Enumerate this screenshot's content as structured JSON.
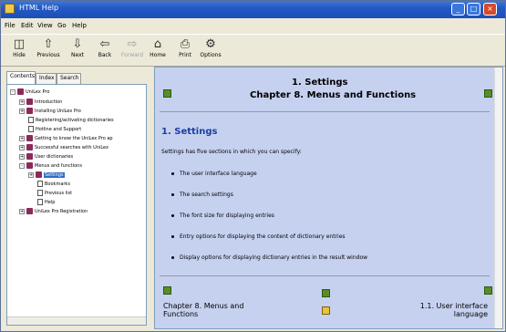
{
  "window": {
    "title": "HTML Help"
  },
  "menu": [
    "File",
    "Edit",
    "View",
    "Go",
    "Help"
  ],
  "toolbar": [
    {
      "label": "Hide",
      "icon": "hide-icon",
      "enabled": true
    },
    {
      "label": "Previous",
      "icon": "previous-icon",
      "enabled": true
    },
    {
      "label": "Next",
      "icon": "next-icon",
      "enabled": true
    },
    {
      "label": "Back",
      "icon": "back-icon",
      "enabled": true
    },
    {
      "label": "Forward",
      "icon": "forward-icon",
      "enabled": false
    },
    {
      "label": "Home",
      "icon": "home-icon",
      "enabled": true
    },
    {
      "label": "Print",
      "icon": "print-icon",
      "enabled": true
    },
    {
      "label": "Options",
      "icon": "options-icon",
      "enabled": true
    }
  ],
  "tabs": [
    "Contents",
    "Index",
    "Search"
  ],
  "tree": {
    "root": "UniLex Pro",
    "items": [
      {
        "label": "Introduction",
        "kind": "book",
        "expander": "+"
      },
      {
        "label": "Installing UniLex Pro",
        "kind": "book",
        "expander": "+"
      },
      {
        "label": "Registering/activating dictionaries",
        "kind": "page",
        "expander": ""
      },
      {
        "label": "Hotline and Support",
        "kind": "page",
        "expander": ""
      },
      {
        "label": "Getting to know the UniLex Pro ap",
        "kind": "book",
        "expander": "+"
      },
      {
        "label": "Successful searches with UniLex",
        "kind": "book",
        "expander": "+"
      },
      {
        "label": "User dictionaries",
        "kind": "book",
        "expander": "+"
      },
      {
        "label": "Menus and functions",
        "kind": "book",
        "expander": "-"
      },
      {
        "label": "Settings",
        "kind": "book",
        "expander": "+",
        "selected": true
      },
      {
        "label": "Bookmarks",
        "kind": "page",
        "expander": ""
      },
      {
        "label": "Previous list",
        "kind": "page",
        "expander": ""
      },
      {
        "label": "Help",
        "kind": "page",
        "expander": ""
      },
      {
        "label": "UniLex Pro Registration",
        "kind": "book",
        "expander": "+"
      }
    ]
  },
  "content": {
    "header_line1": "1. Settings",
    "header_line2": "Chapter 8. Menus and Functions",
    "section_title": "1. Settings",
    "intro": "Settings has five sections in which you can specify:",
    "bullets": [
      "The user interface language",
      "The search settings",
      "The font size for displaying entries",
      "Entry options for displaying the content of dictionary entries",
      "Display options for displaying dictionary entries in the result window"
    ],
    "footer_left": "Chapter 8. Menus and Functions",
    "footer_right": "1.1. User interface language"
  }
}
